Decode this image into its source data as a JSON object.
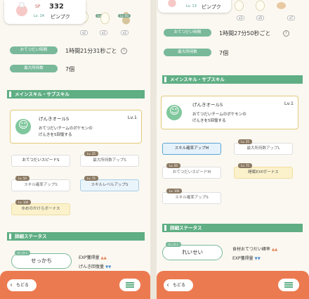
{
  "left": {
    "header": {
      "sp_label": "SP",
      "sp_value": "332",
      "level": "Lv. 14",
      "name": "ピンプク"
    },
    "ingredients": [
      {
        "level": "Lv. 30",
        "count": "x2"
      },
      {
        "level": "Lv. 60",
        "count": "x2"
      }
    ],
    "stats": [
      {
        "label": "おてつだい時間",
        "value": "1時間21分31秒ごと",
        "info": "i"
      },
      {
        "label": "最大所持数",
        "value": "7個"
      }
    ],
    "main_section": "メインスキル・サブスキル",
    "skill": {
      "name": "げんきオールS",
      "level": "Lv.1",
      "desc_line1": "おてつだいチームのポケモンの",
      "desc_line2": "げんきを5回復する"
    },
    "subskills": [
      {
        "label": "おてつだいスピードS",
        "lv": "",
        "style": "white-strong"
      },
      {
        "label": "最大所持数アップS",
        "lv": "Lv. 25",
        "style": ""
      },
      {
        "label": "スキル確率アップS",
        "lv": "Lv. 50",
        "style": ""
      },
      {
        "label": "スキルレベルアップS",
        "lv": "Lv. 75",
        "style": "blue"
      },
      {
        "label": "ゆめのかけらボーナス",
        "lv": "Lv. 100",
        "style": "gold"
      }
    ],
    "detail_section": "詳細ステータス",
    "nature": {
      "badge": "せいかく",
      "value": "せっかち"
    },
    "nature_stats": [
      {
        "label": "EXP獲得量",
        "arrows": "▲▲",
        "dir": "up"
      },
      {
        "label": "げんき回復量",
        "arrows": "▼▼",
        "dir": "down"
      }
    ],
    "footer": {
      "back": "もどる"
    }
  },
  "right": {
    "header": {
      "level": "Lv. 13",
      "name": "ピンプク"
    },
    "ingredients": [
      {
        "count": "x3"
      },
      {
        "count": "x5"
      },
      {
        "count": "x7"
      }
    ],
    "stats": [
      {
        "label": "おてつだい時間",
        "value": "1時間27分50秒ごと",
        "info": "i"
      },
      {
        "label": "最大所持数",
        "value": "7個"
      }
    ],
    "main_section": "メインスキル・サブスキル",
    "skill": {
      "name": "げんきオールS",
      "level": "Lv.1",
      "desc_line1": "おてつだいチームのポケモンの",
      "desc_line2": "げんきを5回復する"
    },
    "subskills": [
      {
        "label": "スキル確率アップM",
        "lv": "",
        "style": "selected"
      },
      {
        "label": "最大所持数アップL",
        "lv": "Lv. 25",
        "style": ""
      },
      {
        "label": "おてつだいスピードM",
        "lv": "Lv. 50",
        "style": ""
      },
      {
        "label": "睡眠EXPボーナス",
        "lv": "Lv. 75",
        "style": "gold"
      },
      {
        "label": "スキル確率アップS",
        "lv": "Lv. 100",
        "style": ""
      }
    ],
    "detail_section": "詳細ステータス",
    "nature": {
      "badge": "せいかく",
      "value": "れいせい"
    },
    "nature_stats": [
      {
        "label": "食材おてつだい確率",
        "arrows": "▲▲",
        "dir": "up"
      },
      {
        "label": "EXP獲得量",
        "arrows": "▼▼",
        "dir": "down"
      }
    ],
    "footer": {
      "back": "もどる"
    }
  },
  "colors": {
    "accent_green": "#79b99a",
    "footer_orange": "#ec7a50",
    "gold_border": "#e3c97a",
    "selected_blue": "#5aa6d6"
  }
}
